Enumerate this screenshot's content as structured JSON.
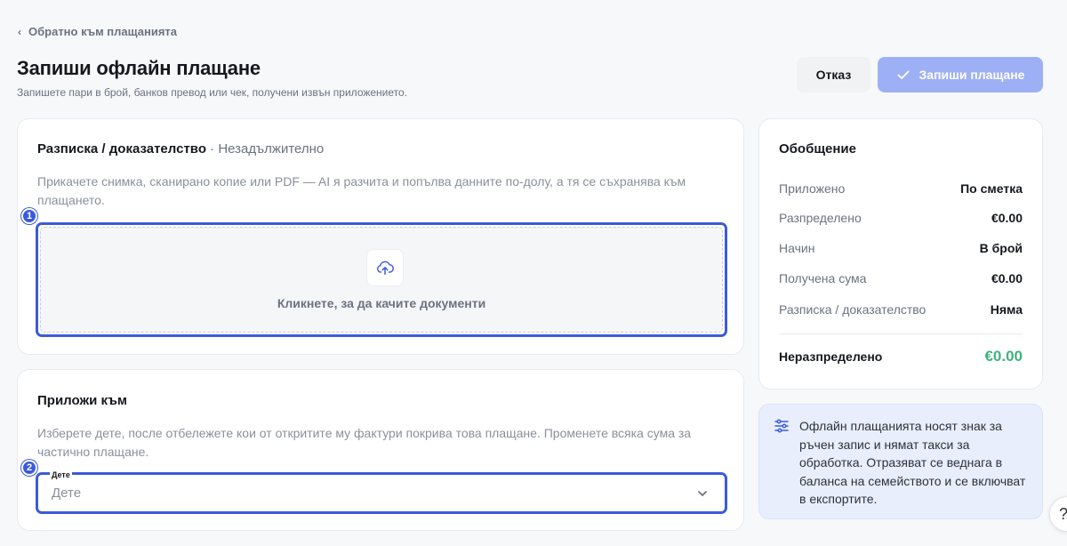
{
  "nav": {
    "back_label": "Обратно към плащанията"
  },
  "header": {
    "title": "Запиши офлайн плащане",
    "subtitle": "Запишете пари в брой, банков превод или чек, получени извън приложението.",
    "cancel_label": "Отказ",
    "save_label": "Запиши плащане"
  },
  "receipt": {
    "title": "Разписка / доказателство",
    "optional": " · Незадължително",
    "description": "Прикачете снимка, сканирано копие или PDF — AI я разчита и попълва данните по-долу, а тя се съхранява към плащането.",
    "marker": "1",
    "upload_label": "Кликнете, за да качите документи",
    "upload_icon": "cloud-upload-icon"
  },
  "apply": {
    "title": "Приложи към",
    "description": "Изберете дете, после отбележете кои от откритите му фактури покрива това плащане. Променете всяка сума за частично плащане.",
    "marker": "2",
    "child_label": "Дете",
    "child_placeholder": "Дете"
  },
  "summary": {
    "title": "Обобщение",
    "rows": [
      {
        "key": "Приложено",
        "value": "По сметка"
      },
      {
        "key": "Разпределено",
        "value": "€0.00"
      },
      {
        "key": "Начин",
        "value": "В брой"
      },
      {
        "key": "Получена сума",
        "value": "€0.00"
      },
      {
        "key": "Разписка / доказателство",
        "value": "Няма"
      }
    ],
    "total_label": "Неразпределено",
    "total_value": "€0.00"
  },
  "info": {
    "icon": "sliders-icon",
    "text": "Офлайн плащанията носят знак за ръчен запис и нямат такси за обработка. Отразяват се веднага в баланса на семейството и се включват в експортите."
  },
  "help": {
    "label": "?"
  },
  "colors": {
    "accent": "#3b5bdb",
    "save_button": "#9eb0f5",
    "success": "#3fb27f",
    "info_bg": "#e9eefc"
  }
}
